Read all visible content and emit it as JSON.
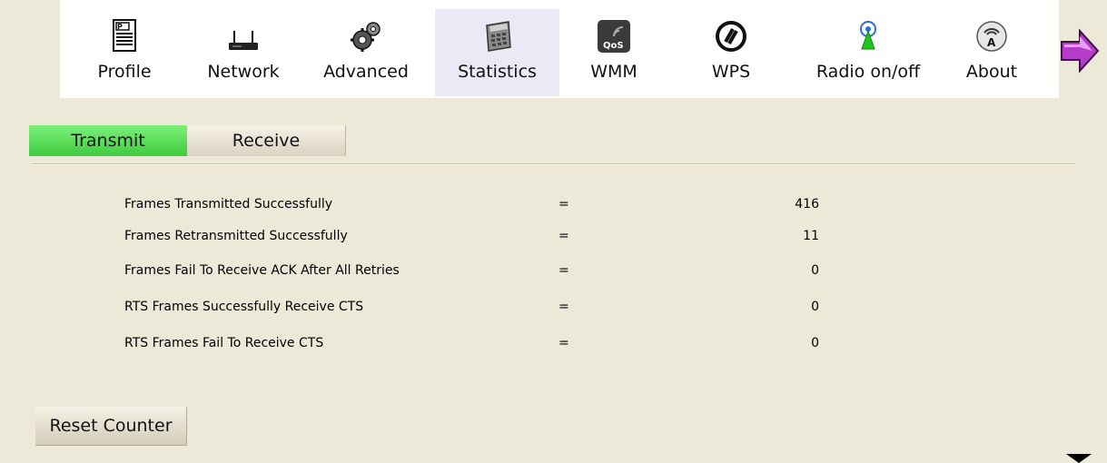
{
  "toolbar": {
    "items": [
      {
        "label": "Profile",
        "icon": "profile-icon"
      },
      {
        "label": "Network",
        "icon": "network-icon"
      },
      {
        "label": "Advanced",
        "icon": "gears-icon"
      },
      {
        "label": "Statistics",
        "icon": "calculator-icon"
      },
      {
        "label": "WMM",
        "icon": "qos-icon"
      },
      {
        "label": "WPS",
        "icon": "wps-icon"
      },
      {
        "label": "Radio on/off",
        "icon": "antenna-icon"
      },
      {
        "label": "About",
        "icon": "about-icon"
      }
    ],
    "active": "Statistics",
    "more_icon": "arrow-right-icon"
  },
  "tabs": {
    "transmit": "Transmit",
    "receive": "Receive"
  },
  "stats": [
    {
      "label": "Frames Transmitted Successfully",
      "eq": "=",
      "value": "416"
    },
    {
      "label": "Frames Retransmitted Successfully",
      "eq": "=",
      "value": "11"
    },
    {
      "label": "Frames Fail To Receive ACK After All Retries",
      "eq": "=",
      "value": "0"
    },
    {
      "label": "RTS Frames Successfully Receive CTS",
      "eq": "=",
      "value": "0"
    },
    {
      "label": "RTS Frames Fail To Receive CTS",
      "eq": "=",
      "value": "0"
    }
  ],
  "reset_button": "Reset Counter",
  "colors": {
    "background": "#ece9d8",
    "active_tab": "#4fd94f",
    "active_tool": "#ece9f7"
  }
}
